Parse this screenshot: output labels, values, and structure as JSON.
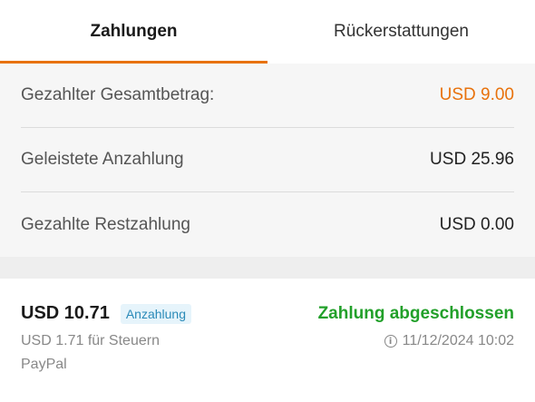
{
  "tabs": [
    {
      "label": "Zahlungen",
      "active": true
    },
    {
      "label": "Rückerstattungen",
      "active": false
    }
  ],
  "summary": {
    "rows": [
      {
        "label": "Gezahlter Gesamtbetrag:",
        "value": "USD 9.00"
      },
      {
        "label": "Geleistete Anzahlung",
        "value": "USD 25.96"
      },
      {
        "label": "Gezahlte Restzahlung",
        "value": "USD 0.00"
      }
    ]
  },
  "payment": {
    "amount": "USD 10.71",
    "badge": "Anzahlung",
    "status": "Zahlung abgeschlossen",
    "tax": "USD 1.71 für Steuern",
    "datetime": "11/12/2024 10:02",
    "method": "PayPal",
    "info_icon": "i"
  },
  "colors": {
    "accent": "#e8720c",
    "success": "#22a02a",
    "badge_bg": "#e6f4fb",
    "badge_text": "#2a8ab8"
  }
}
